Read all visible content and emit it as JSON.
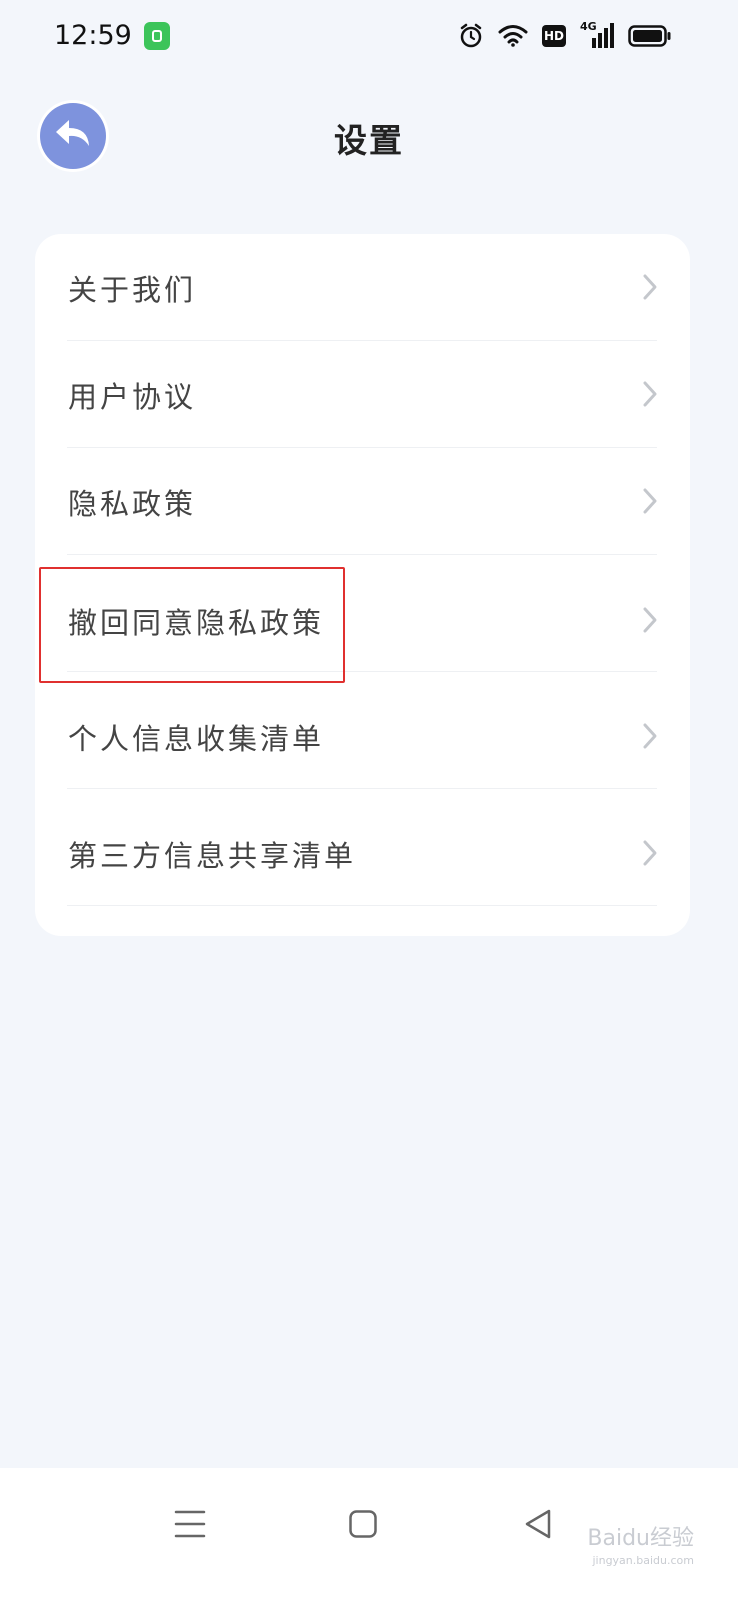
{
  "status_bar": {
    "time": "12:59",
    "network": "4G",
    "hd": "HD",
    "icons": [
      "alarm-icon",
      "wifi-icon",
      "hd-icon",
      "signal-icon",
      "battery-icon"
    ]
  },
  "header": {
    "title": "设置",
    "back_icon": "back-arrow-icon"
  },
  "menu": {
    "items": [
      {
        "label": "关于我们"
      },
      {
        "label": "用户协议"
      },
      {
        "label": "隐私政策"
      },
      {
        "label": "撤回同意隐私政策"
      },
      {
        "label": "个人信息收集清单"
      },
      {
        "label": "第三方信息共享清单"
      }
    ]
  },
  "nav_bar": {
    "icons": [
      "menu-icon",
      "home-icon",
      "back-triangle-icon"
    ]
  },
  "watermark": {
    "text": "Baidu经验",
    "url": "jingyan.baidu.com"
  },
  "colors": {
    "background": "#f3f6fb",
    "card": "#ffffff",
    "back_button": "#7e93dd",
    "highlight": "#e0302f"
  }
}
